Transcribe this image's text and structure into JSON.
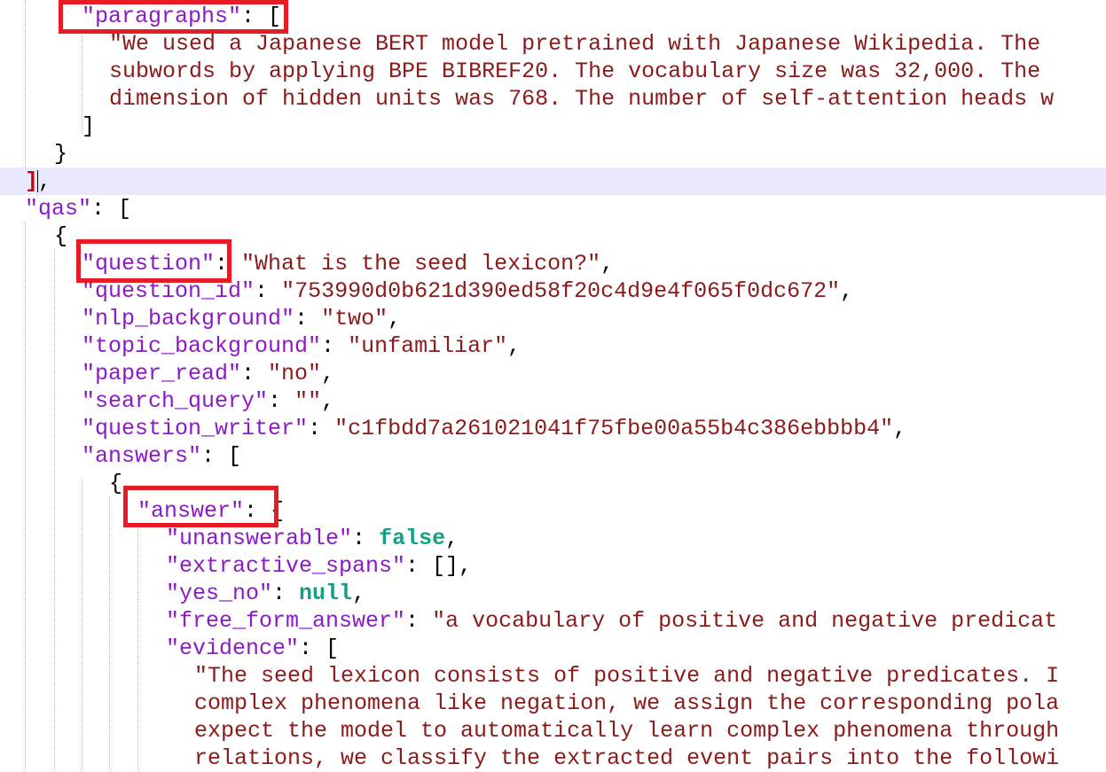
{
  "lines": [
    [
      {
        "c": "k",
        "t": "\"paragraphs\""
      },
      {
        "c": "t",
        "t": ": ["
      }
    ],
    [
      {
        "c": "s",
        "t": "\"We used a Japanese BERT model pretrained with Japanese Wikipedia. The"
      }
    ],
    [
      {
        "c": "s",
        "t": "subwords by applying BPE BIBREF20. The vocabulary size was 32,000. The"
      }
    ],
    [
      {
        "c": "s",
        "t": "dimension of hidden units was 768. The number of self-attention heads w"
      }
    ],
    [
      {
        "c": "t",
        "t": "]"
      }
    ],
    [
      {
        "c": "t",
        "t": "}"
      }
    ],
    [
      {
        "c": "br",
        "t": "]"
      },
      {
        "c": "t",
        "t": ","
      }
    ],
    [
      {
        "c": "k",
        "t": "\"qas\""
      },
      {
        "c": "t",
        "t": ": ["
      }
    ],
    [
      {
        "c": "t",
        "t": "{"
      }
    ],
    [
      {
        "c": "k",
        "t": "\"question\""
      },
      {
        "c": "t",
        "t": ": "
      },
      {
        "c": "s",
        "t": "\"What is the seed lexicon?\""
      },
      {
        "c": "t",
        "t": ","
      }
    ],
    [
      {
        "c": "k",
        "t": "\"question_id\""
      },
      {
        "c": "t",
        "t": ": "
      },
      {
        "c": "s",
        "t": "\"753990d0b621d390ed58f20c4d9e4f065f0dc672\""
      },
      {
        "c": "t",
        "t": ","
      }
    ],
    [
      {
        "c": "k",
        "t": "\"nlp_background\""
      },
      {
        "c": "t",
        "t": ": "
      },
      {
        "c": "s",
        "t": "\"two\""
      },
      {
        "c": "t",
        "t": ","
      }
    ],
    [
      {
        "c": "k",
        "t": "\"topic_background\""
      },
      {
        "c": "t",
        "t": ": "
      },
      {
        "c": "s",
        "t": "\"unfamiliar\""
      },
      {
        "c": "t",
        "t": ","
      }
    ],
    [
      {
        "c": "k",
        "t": "\"paper_read\""
      },
      {
        "c": "t",
        "t": ": "
      },
      {
        "c": "s",
        "t": "\"no\""
      },
      {
        "c": "t",
        "t": ","
      }
    ],
    [
      {
        "c": "k",
        "t": "\"search_query\""
      },
      {
        "c": "t",
        "t": ": "
      },
      {
        "c": "s",
        "t": "\"\""
      },
      {
        "c": "t",
        "t": ","
      }
    ],
    [
      {
        "c": "k",
        "t": "\"question_writer\""
      },
      {
        "c": "t",
        "t": ": "
      },
      {
        "c": "s",
        "t": "\"c1fbdd7a261021041f75fbe00a55b4c386ebbbb4\""
      },
      {
        "c": "t",
        "t": ","
      }
    ],
    [
      {
        "c": "k",
        "t": "\"answers\""
      },
      {
        "c": "t",
        "t": ": ["
      }
    ],
    [
      {
        "c": "t",
        "t": "{"
      }
    ],
    [
      {
        "c": "k",
        "t": "\"answer\""
      },
      {
        "c": "t",
        "t": ": {"
      }
    ],
    [
      {
        "c": "k",
        "t": "\"unanswerable\""
      },
      {
        "c": "t",
        "t": ": "
      },
      {
        "c": "b",
        "t": "false"
      },
      {
        "c": "t",
        "t": ","
      }
    ],
    [
      {
        "c": "k",
        "t": "\"extractive_spans\""
      },
      {
        "c": "t",
        "t": ": [],"
      }
    ],
    [
      {
        "c": "k",
        "t": "\"yes_no\""
      },
      {
        "c": "t",
        "t": ": "
      },
      {
        "c": "b",
        "t": "null"
      },
      {
        "c": "t",
        "t": ","
      }
    ],
    [
      {
        "c": "k",
        "t": "\"free_form_answer\""
      },
      {
        "c": "t",
        "t": ": "
      },
      {
        "c": "s",
        "t": "\"a vocabulary of positive and negative predicat"
      }
    ],
    [
      {
        "c": "k",
        "t": "\"evidence\""
      },
      {
        "c": "t",
        "t": ": ["
      }
    ],
    [
      {
        "c": "s",
        "t": "\"The seed lexicon consists of positive and negative predicates. I"
      }
    ],
    [
      {
        "c": "s",
        "t": "complex phenomena like negation, we assign the corresponding pola"
      }
    ],
    [
      {
        "c": "s",
        "t": "expect the model to automatically learn complex phenomena through"
      }
    ],
    [
      {
        "c": "s",
        "t": "relations, we classify the extracted event pairs into the followi"
      }
    ]
  ]
}
